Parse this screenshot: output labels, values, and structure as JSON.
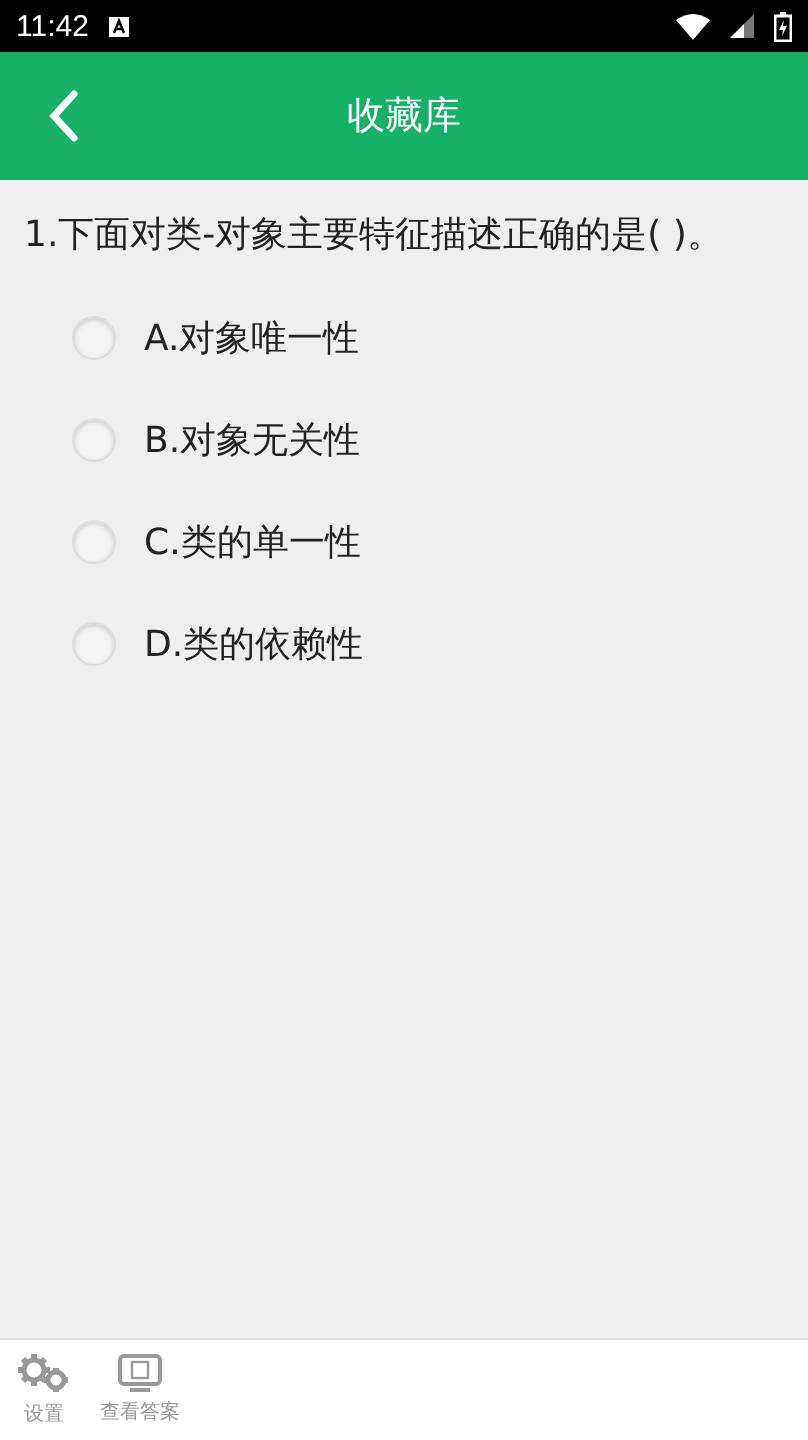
{
  "status_bar": {
    "time": "11:42"
  },
  "app_bar": {
    "title": "收藏库"
  },
  "question": {
    "text": "1.下面对类-对象主要特征描述正确的是( )。",
    "options": [
      {
        "label": "A.对象唯一性",
        "selected": false
      },
      {
        "label": "B.对象无关性",
        "selected": false
      },
      {
        "label": "C.类的单一性",
        "selected": false
      },
      {
        "label": "D.类的依赖性",
        "selected": false
      }
    ]
  },
  "bottom_bar": {
    "items": [
      {
        "kind": "settings",
        "label": "设置"
      },
      {
        "kind": "answer",
        "label": "查看答案"
      }
    ]
  }
}
